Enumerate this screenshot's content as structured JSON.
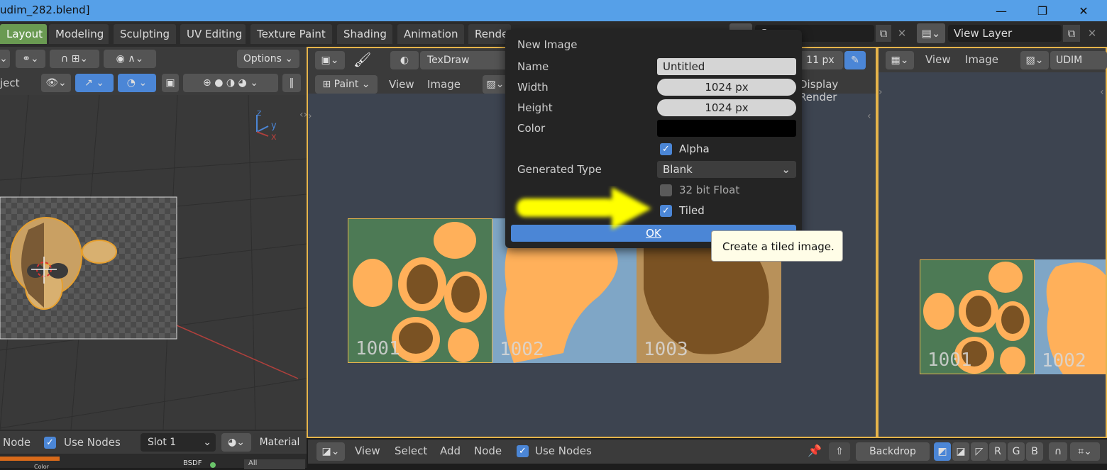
{
  "window": {
    "title": "udim_282.blend]",
    "controls": [
      "—",
      "❐",
      "✕"
    ]
  },
  "workspace_tabs": [
    "Layout",
    "Modeling",
    "Sculpting",
    "UV Editing",
    "Texture Paint",
    "Shading",
    "Animation",
    "Rende"
  ],
  "scene_search": {
    "value": "Sc"
  },
  "view_layer": {
    "label": "View Layer"
  },
  "viewport3d": {
    "options_label": "Options",
    "object_label": "ject",
    "axis_x": "x",
    "axis_y": "y",
    "axis_z": "z"
  },
  "image_editor": {
    "image_name": "TexDraw",
    "mode": "Paint",
    "menu_view": "View",
    "menu_image": "Image",
    "radius": "11 px",
    "display_render": "Display Render",
    "tiles": [
      "1001",
      "1002",
      "1003"
    ]
  },
  "uv_editor": {
    "menu_view": "View",
    "menu_image": "Image",
    "image_name": "UDIM",
    "tiles": [
      "1001",
      "1002"
    ]
  },
  "shader_left": {
    "node_label": "Node",
    "use_nodes": "Use Nodes",
    "slot": "Slot 1",
    "material": "Material",
    "bsdf": "BSDF",
    "all": "All",
    "color": "Color"
  },
  "node_bar": {
    "view": "View",
    "select": "Select",
    "add": "Add",
    "node": "Node",
    "use_nodes": "Use Nodes",
    "backdrop": "Backdrop",
    "channels": [
      "R",
      "G",
      "B"
    ]
  },
  "dialog": {
    "title": "New Image",
    "name_label": "Name",
    "name_value": "Untitled",
    "width_label": "Width",
    "width_value": "1024 px",
    "height_label": "Height",
    "height_value": "1024 px",
    "color_label": "Color",
    "color_value": "#000000",
    "alpha_label": "Alpha",
    "alpha_checked": true,
    "generated_type_label": "Generated Type",
    "generated_type_value": "Blank",
    "float_label": "32 bit Float",
    "float_checked": false,
    "tiled_label": "Tiled",
    "tiled_checked": true,
    "ok_label": "OK"
  },
  "tooltip": {
    "text": "Create a tiled image."
  },
  "colors": {
    "accent": "#4b86d6",
    "highlight_border": "#e6b44a",
    "annotation_arrow": "#ffff00",
    "tile_green": "#4d7a55",
    "tile_orange": "#ffb05a",
    "tile_brown": "#7a5223",
    "tile_blue": "#7fa6c6"
  }
}
